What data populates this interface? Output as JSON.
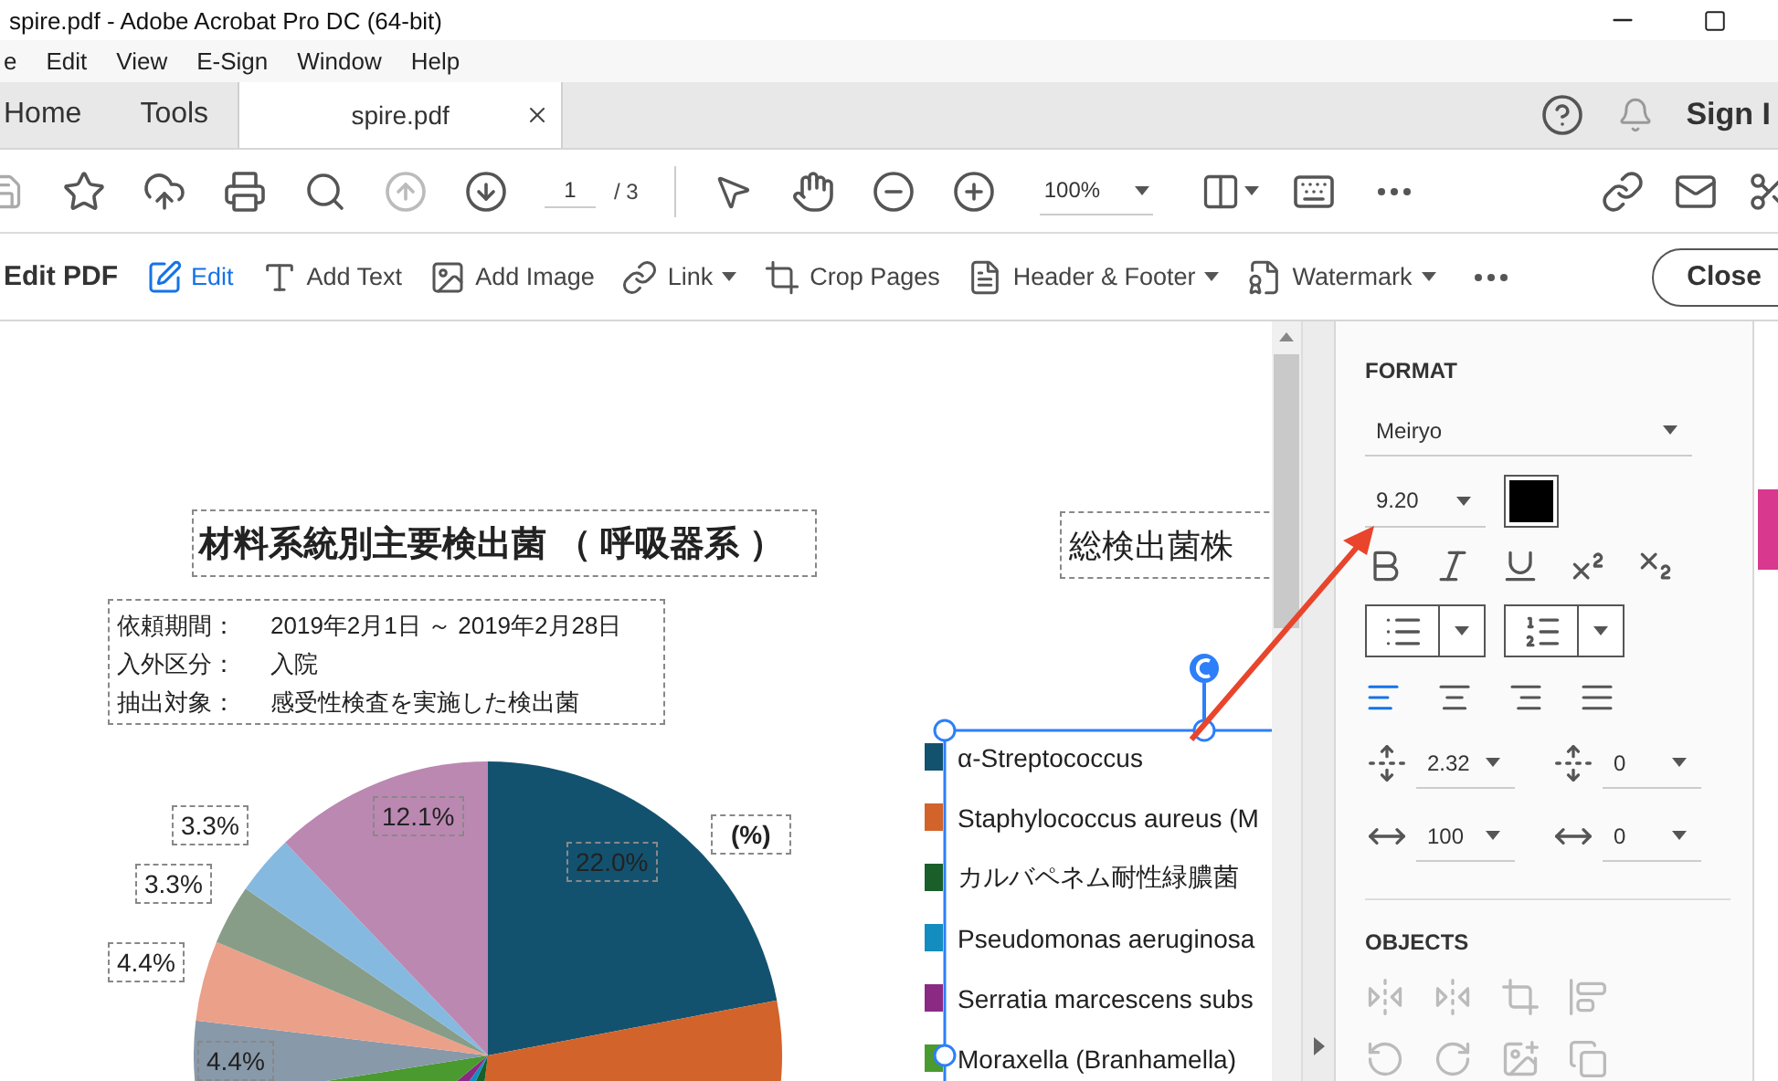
{
  "window": {
    "title": "spire.pdf - Adobe Acrobat Pro DC (64-bit)"
  },
  "menu": [
    "e",
    "Edit",
    "View",
    "E-Sign",
    "Window",
    "Help"
  ],
  "tabs": [
    {
      "label": "Home",
      "kind": "nav",
      "selected": false
    },
    {
      "label": "Tools",
      "kind": "nav",
      "selected": false
    },
    {
      "label": "spire.pdf",
      "kind": "document",
      "selected": true
    }
  ],
  "account": {
    "label": "Sign I"
  },
  "toolbar": {
    "prev_disabled": true,
    "page": "1",
    "page_total": "/ 3",
    "zoom": "100%"
  },
  "edit_toolbar": {
    "title": "Edit PDF",
    "close": "Close",
    "tools": [
      {
        "label": "Edit",
        "kind": "edit",
        "selected": true,
        "menu": false
      },
      {
        "label": "Add Text",
        "kind": "add-text",
        "selected": false,
        "menu": false
      },
      {
        "label": "Add Image",
        "kind": "add-image",
        "selected": false,
        "menu": false
      },
      {
        "label": "Link",
        "kind": "link",
        "selected": false,
        "menu": true
      },
      {
        "label": "Crop Pages",
        "kind": "crop",
        "selected": false,
        "menu": false
      },
      {
        "label": "Header & Footer",
        "kind": "header-footer",
        "selected": false,
        "menu": true
      },
      {
        "label": "Watermark",
        "kind": "watermark",
        "selected": false,
        "menu": true
      }
    ]
  },
  "document": {
    "chart_title": "材料系統別主要検出菌 （ 呼吸器系 ）",
    "info": [
      {
        "label": "依頼期間：",
        "value": "2019年2月1日 ～ 2019年2月28日"
      },
      {
        "label": "入外区分：",
        "value": "入院"
      },
      {
        "label": "抽出対象：",
        "value": "感受性検査を実施した検出菌"
      }
    ],
    "unit": "(%)",
    "pie_labels": [
      "22.0%",
      "12.1%",
      "3.3%",
      "3.3%",
      "4.4%",
      "4.4%"
    ],
    "second_title": "総検出菌株",
    "legend": [
      {
        "label": "α-Streptococcus",
        "color": "#13526f"
      },
      {
        "label": "Staphylococcus aureus (M",
        "color": "#d2632b"
      },
      {
        "label": "カルバペネム耐性緑膿菌",
        "color": "#1a5e2a"
      },
      {
        "label": "Pseudomonas aeruginosa",
        "color": "#138dbf"
      },
      {
        "label": "Serratia marcescens subs",
        "color": "#8a2a83"
      },
      {
        "label": "Moraxella (Branhamella)",
        "color": "#4a9a2f"
      }
    ]
  },
  "format_panel": {
    "heading": "FORMAT",
    "font": "Meiryo",
    "size": "9.20",
    "color": "#000000",
    "alignments": [
      {
        "kind": "left",
        "selected": true
      },
      {
        "kind": "center",
        "selected": false
      },
      {
        "kind": "right",
        "selected": false
      },
      {
        "kind": "justify",
        "selected": false
      }
    ],
    "line_spacing": "2.32",
    "paragraph_spacing": "0",
    "horizontal_scale": "100",
    "tracking": "0",
    "objects_heading": "OBJECTS"
  }
}
